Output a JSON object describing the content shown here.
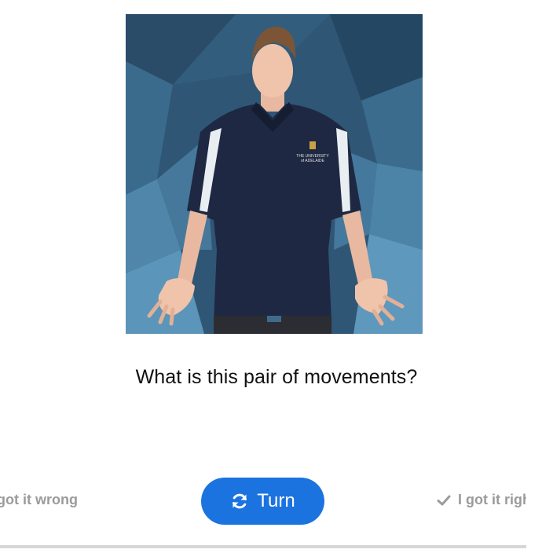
{
  "card": {
    "image": {
      "subject": "person-in-polo-shirt",
      "logo_text_line1": "THE UNIVERSITY",
      "logo_text_line2": "of ADELAIDE"
    },
    "question": "What is this pair of movements?"
  },
  "controls": {
    "wrong_label": "I got it wrong",
    "turn_label": "Turn",
    "turn_icon": "refresh-icon",
    "right_label": "I got it right",
    "right_icon": "check-icon"
  },
  "colors": {
    "accent": "#1b73e0",
    "muted_text": "#9b9b9b",
    "track": "#d6d6d6"
  }
}
